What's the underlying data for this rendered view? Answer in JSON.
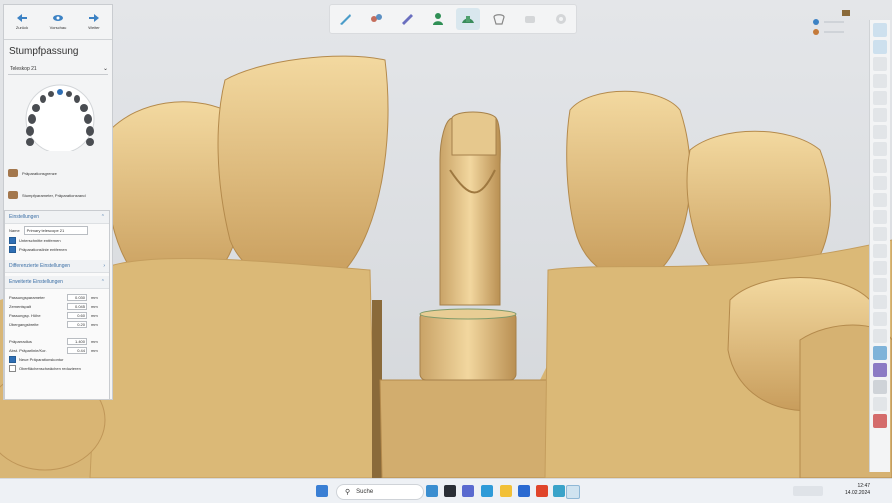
{
  "nav": {
    "back_label": "Zurück",
    "preview_label": "Vorschau",
    "next_label": "Weiter"
  },
  "panel": {
    "title": "Stumpfpassung",
    "dropdown_value": "Teleskop 21",
    "list": [
      {
        "label": "Präparationsgrenze"
      },
      {
        "label": "Stumpfparameter, Präparationsrand"
      }
    ]
  },
  "settings": {
    "header": "Einstellungen",
    "name_label": "Name",
    "name_value": "Primary telescope 21",
    "checkboxes": [
      {
        "label": "Unterschnitte entfernen",
        "checked": true
      },
      {
        "label": "Präparationslinie entfernen",
        "checked": true
      }
    ],
    "diff_header": "Differenzierte Einstellungen",
    "ext_header": "Erweiterte Einstellungen",
    "params": [
      {
        "label": "Passungsparameter",
        "value": "0.030",
        "unit": "mm"
      },
      {
        "label": "Zementspalt",
        "value": "0.045",
        "unit": "mm"
      },
      {
        "label": "Passungsp. Höhe",
        "value": "0.60",
        "unit": "mm"
      },
      {
        "label": "Übergangsbreite",
        "value": "0.20",
        "unit": "mm"
      },
      {
        "label": "Präparradius",
        "value": "1.400",
        "unit": "mm"
      },
      {
        "label": "Abst. Präparlinie/Kor.",
        "value": "0.44",
        "unit": "mm"
      }
    ],
    "bottom_checkboxes": [
      {
        "label": "Neue Präparationskontur",
        "checked": true
      },
      {
        "label": "Oberflächenschwächen reduzieren",
        "checked": false
      }
    ]
  },
  "taskbar": {
    "search_placeholder": "Suche",
    "time": "12:47",
    "date": "14.02.2024"
  },
  "colors": {
    "model": "#dfc07f",
    "accent": "#2f6fb5"
  }
}
